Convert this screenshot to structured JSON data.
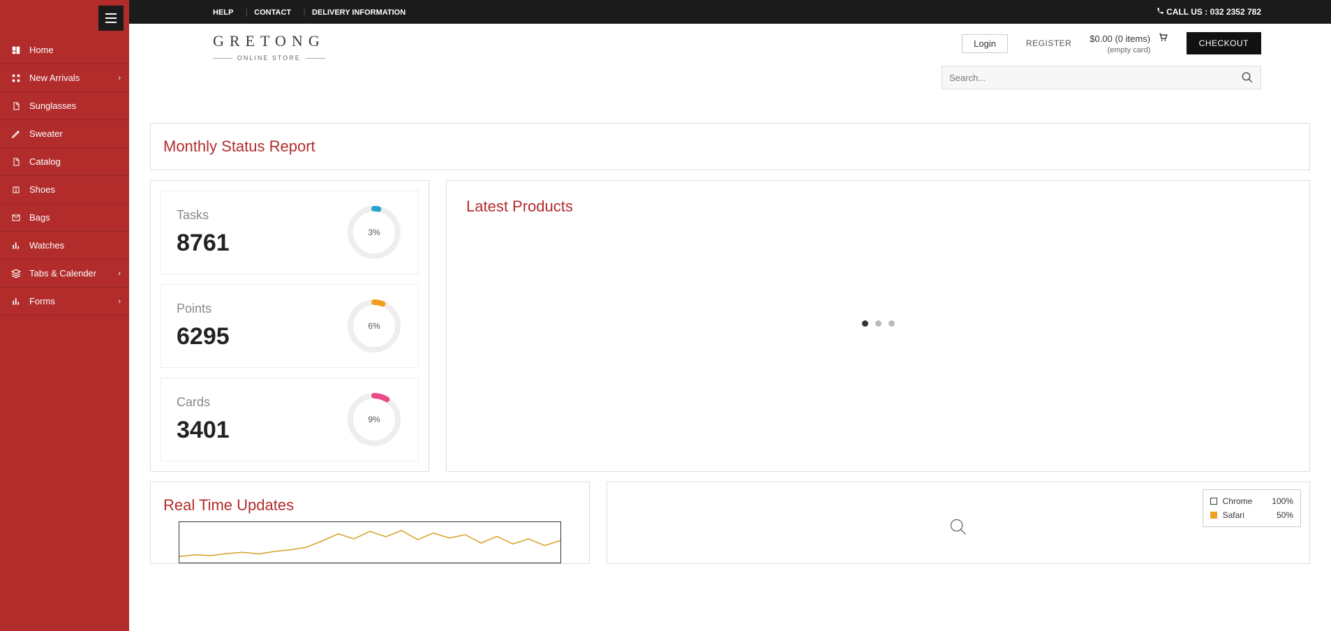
{
  "sidebar": {
    "items": [
      {
        "label": "Home",
        "icon": "dashboard-icon",
        "chevron": false
      },
      {
        "label": "New Arrivals",
        "icon": "grid-icon",
        "chevron": true
      },
      {
        "label": "Sunglasses",
        "icon": "file-icon",
        "chevron": false
      },
      {
        "label": "Sweater",
        "icon": "pencil-icon",
        "chevron": false
      },
      {
        "label": "Catalog",
        "icon": "file-icon",
        "chevron": false
      },
      {
        "label": "Shoes",
        "icon": "book-icon",
        "chevron": false
      },
      {
        "label": "Bags",
        "icon": "mail-icon",
        "chevron": false
      },
      {
        "label": "Watches",
        "icon": "bar-chart-icon",
        "chevron": false
      },
      {
        "label": "Tabs & Calender",
        "icon": "layers-icon",
        "chevron": true
      },
      {
        "label": "Forms",
        "icon": "bar-chart-icon",
        "chevron": true
      }
    ]
  },
  "topbar": {
    "links": [
      "HELP",
      "CONTACT",
      "DELIVERY INFORMATION"
    ],
    "call_label": "CALL US : 032 2352 782"
  },
  "logo": {
    "title": "GRETONG",
    "subtitle": "ONLINE STORE"
  },
  "header": {
    "login": "Login",
    "register": "REGISTER",
    "cart_total": "$0.00 (0 items)",
    "cart_sub": "(empty card)",
    "checkout": "CHECKOUT"
  },
  "search": {
    "placeholder": "Search..."
  },
  "monthly_title": "Monthly Status Report",
  "stats": [
    {
      "label": "Tasks",
      "value": "8761",
      "pct": "3%",
      "pct_num": 3,
      "color": "#2aa3cf"
    },
    {
      "label": "Points",
      "value": "6295",
      "pct": "6%",
      "pct_num": 6,
      "color": "#f0a020"
    },
    {
      "label": "Cards",
      "value": "3401",
      "pct": "9%",
      "pct_num": 9,
      "color": "#e84a8a"
    }
  ],
  "latest_title": "Latest Products",
  "updates_title": "Real Time Updates",
  "legend": [
    {
      "name": "Chrome",
      "pct": "100%",
      "filled": false
    },
    {
      "name": "Safari",
      "pct": "50%",
      "filled": true
    }
  ],
  "chart_data": {
    "type": "line",
    "title": "Real Time Updates",
    "series": [
      {
        "name": "sparkline",
        "values": [
          18,
          22,
          20,
          25,
          28,
          24,
          30,
          34,
          40,
          55,
          72,
          60,
          78,
          65,
          80,
          58,
          74,
          62,
          70,
          50,
          66,
          48,
          60,
          44,
          56
        ]
      }
    ],
    "ylim": [
      0,
      100
    ],
    "xlabel": "",
    "ylabel": ""
  }
}
